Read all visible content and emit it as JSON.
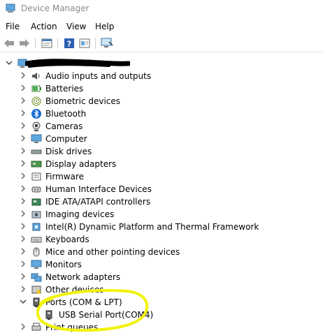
{
  "window": {
    "title": "Device Manager"
  },
  "menu": [
    "File",
    "Action",
    "View",
    "Help"
  ],
  "toolbar": {
    "icons": [
      "back-arrow-icon",
      "forward-arrow-icon",
      "properties-icon",
      "help-icon",
      "update-driver-icon",
      "scan-hardware-icon"
    ]
  },
  "tree": {
    "root_label": "",
    "categories": [
      {
        "label": "Audio inputs and outputs",
        "icon": "speaker-icon",
        "expanded": false
      },
      {
        "label": "Batteries",
        "icon": "battery-icon",
        "expanded": false
      },
      {
        "label": "Biometric devices",
        "icon": "fingerprint-icon",
        "expanded": false
      },
      {
        "label": "Bluetooth",
        "icon": "bluetooth-icon",
        "expanded": false
      },
      {
        "label": "Cameras",
        "icon": "camera-icon",
        "expanded": false
      },
      {
        "label": "Computer",
        "icon": "computer-icon",
        "expanded": false
      },
      {
        "label": "Disk drives",
        "icon": "disk-drive-icon",
        "expanded": false
      },
      {
        "label": "Display adapters",
        "icon": "display-adapter-icon",
        "expanded": false
      },
      {
        "label": "Firmware",
        "icon": "firmware-icon",
        "expanded": false
      },
      {
        "label": "Human Interface Devices",
        "icon": "hid-icon",
        "expanded": false
      },
      {
        "label": "IDE ATA/ATAPI controllers",
        "icon": "ide-controller-icon",
        "expanded": false
      },
      {
        "label": "Imaging devices",
        "icon": "imaging-icon",
        "expanded": false
      },
      {
        "label": "Intel(R) Dynamic Platform and Thermal Framework",
        "icon": "chip-icon",
        "expanded": false
      },
      {
        "label": "Keyboards",
        "icon": "keyboard-icon",
        "expanded": false
      },
      {
        "label": "Mice and other pointing devices",
        "icon": "mouse-icon",
        "expanded": false
      },
      {
        "label": "Monitors",
        "icon": "monitor-icon",
        "expanded": false
      },
      {
        "label": "Network adapters",
        "icon": "network-icon",
        "expanded": false
      },
      {
        "label": "Other devices",
        "icon": "other-devices-icon",
        "expanded": false
      },
      {
        "label": "Ports (COM & LPT)",
        "icon": "port-icon",
        "expanded": true
      },
      {
        "label": "USB Serial Port(COM4)",
        "icon": "port-icon",
        "child": true
      },
      {
        "label": "Print queues",
        "icon": "printer-icon",
        "expanded": false
      }
    ]
  },
  "colors": {
    "annotation": "#f2f20a",
    "title_text": "#8a8a8a",
    "redaction": "#000000"
  }
}
